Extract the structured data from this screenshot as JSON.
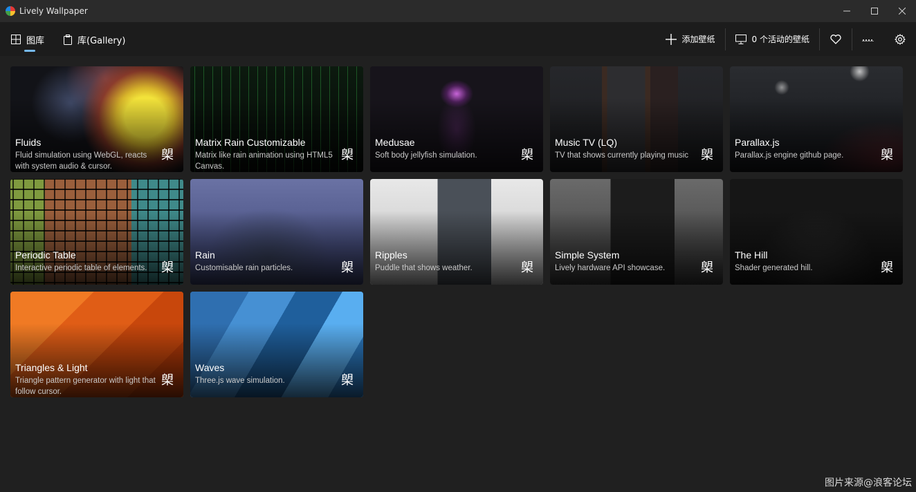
{
  "window": {
    "title": "Lively Wallpaper"
  },
  "nav": {
    "tabs": [
      {
        "label": "图库",
        "icon": "grid-icon",
        "active": true
      },
      {
        "label": "库(Gallery)",
        "icon": "clipboard-icon",
        "active": false
      }
    ],
    "actions": {
      "add_label": "添加壁纸",
      "active_label": "0 个活动的壁纸"
    }
  },
  "accent_color": "#76b9ed",
  "wallpapers": [
    {
      "title": "Fluids",
      "desc": "Fluid simulation using WebGL, reacts with system audio & cursor.",
      "glyph": "㮾"
    },
    {
      "title": "Matrix Rain Customizable",
      "desc": "Matrix like rain animation using HTML5 Canvas.",
      "glyph": "㮾"
    },
    {
      "title": "Medusae",
      "desc": "Soft body jellyfish simulation.",
      "glyph": "㮾"
    },
    {
      "title": "Music TV (LQ)",
      "desc": "TV that shows currently playing music",
      "glyph": "㮾"
    },
    {
      "title": "Parallax.js",
      "desc": "Parallax.js engine github page.",
      "glyph": "㮾"
    },
    {
      "title": "Periodic Table",
      "desc": "Interactive periodic table of elements.",
      "glyph": "㮾"
    },
    {
      "title": "Rain",
      "desc": "Customisable rain particles.",
      "glyph": "㮾"
    },
    {
      "title": "Ripples",
      "desc": "Puddle that shows weather.",
      "glyph": "㮾"
    },
    {
      "title": "Simple System",
      "desc": "Lively hardware API showcase.",
      "glyph": "㮾"
    },
    {
      "title": "The Hill",
      "desc": "Shader generated hill.",
      "glyph": "㮾"
    },
    {
      "title": "Triangles & Light",
      "desc": "Triangle pattern generator with light that follow cursor.",
      "glyph": "㮾"
    },
    {
      "title": "Waves",
      "desc": "Three.js wave simulation.",
      "glyph": "㮾"
    }
  ],
  "watermark": "图片来源@浪客论坛"
}
